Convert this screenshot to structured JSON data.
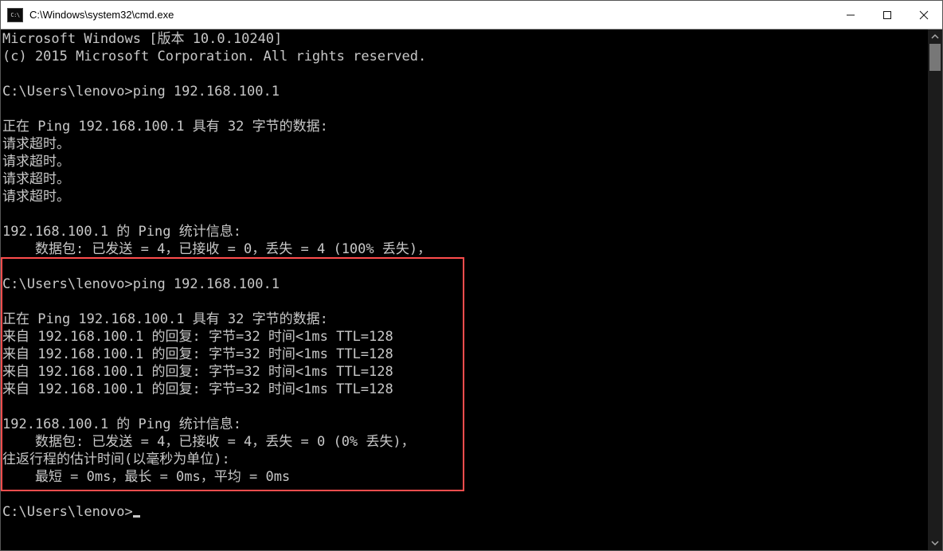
{
  "window": {
    "title": "C:\\Windows\\system32\\cmd.exe"
  },
  "terminal": {
    "lines": {
      "l0": "Microsoft Windows [版本 10.0.10240]",
      "l1": "(c) 2015 Microsoft Corporation. All rights reserved.",
      "l2": "",
      "l3": "C:\\Users\\lenovo>ping 192.168.100.1",
      "l4": "",
      "l5": "正在 Ping 192.168.100.1 具有 32 字节的数据:",
      "l6": "请求超时。",
      "l7": "请求超时。",
      "l8": "请求超时。",
      "l9": "请求超时。",
      "l10": "",
      "l11": "192.168.100.1 的 Ping 统计信息:",
      "l12": "    数据包: 已发送 = 4，已接收 = 0，丢失 = 4 (100% 丢失)，",
      "l13": "",
      "l14": "C:\\Users\\lenovo>ping 192.168.100.1",
      "l15": "",
      "l16": "正在 Ping 192.168.100.1 具有 32 字节的数据:",
      "l17": "来自 192.168.100.1 的回复: 字节=32 时间<1ms TTL=128",
      "l18": "来自 192.168.100.1 的回复: 字节=32 时间<1ms TTL=128",
      "l19": "来自 192.168.100.1 的回复: 字节=32 时间<1ms TTL=128",
      "l20": "来自 192.168.100.1 的回复: 字节=32 时间<1ms TTL=128",
      "l21": "",
      "l22": "192.168.100.1 的 Ping 统计信息:",
      "l23": "    数据包: 已发送 = 4，已接收 = 4，丢失 = 0 (0% 丢失)，",
      "l24": "往返行程的估计时间(以毫秒为单位):",
      "l25": "    最短 = 0ms，最长 = 0ms，平均 = 0ms",
      "l26": "",
      "l27p": "C:\\Users\\lenovo>"
    }
  }
}
